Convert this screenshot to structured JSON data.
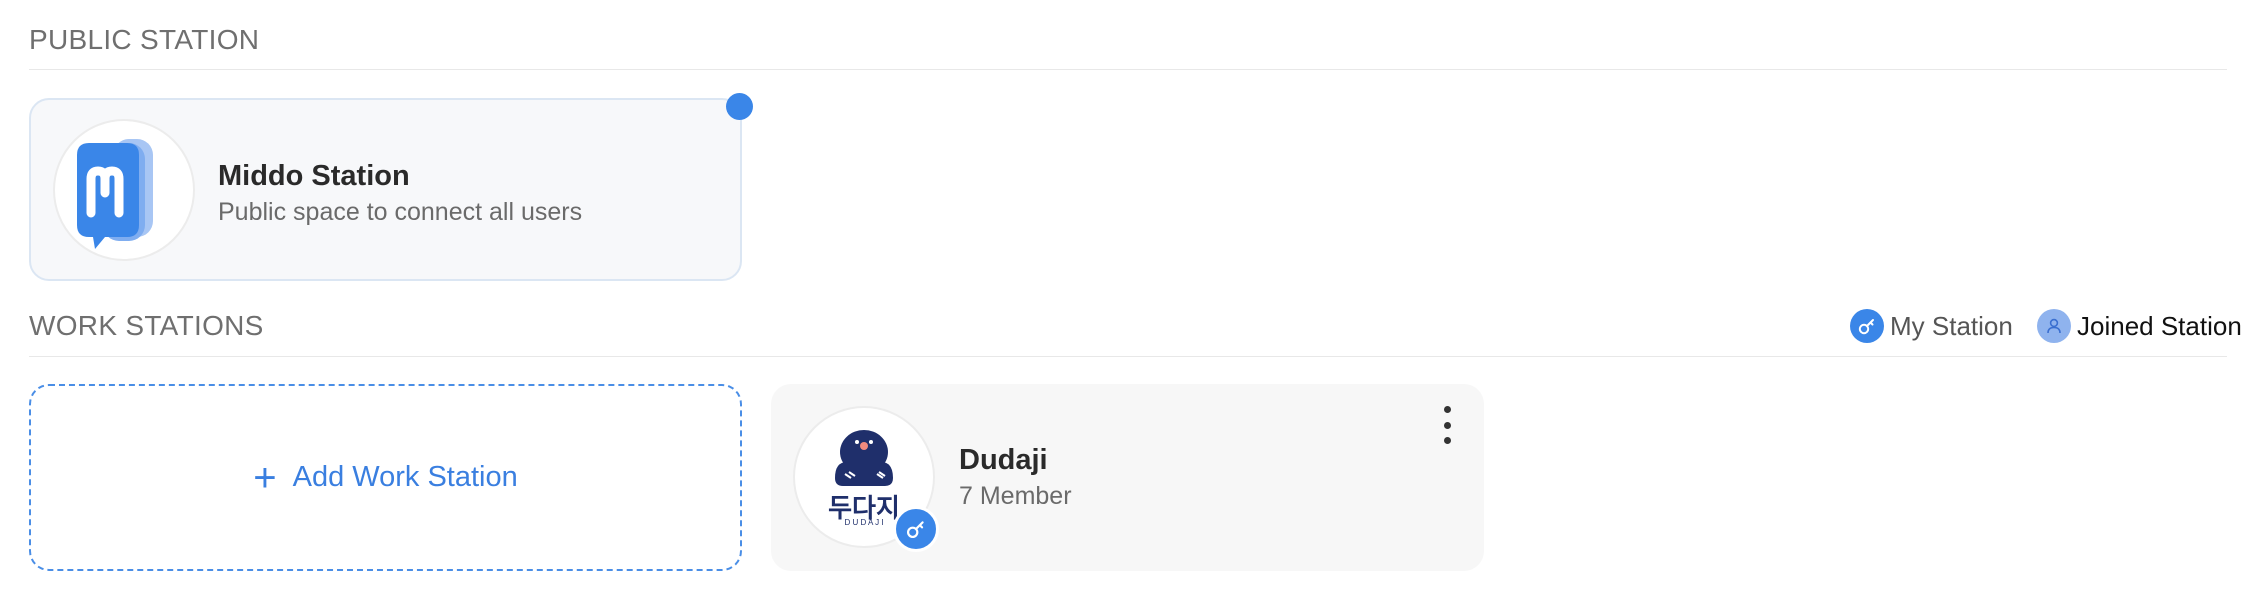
{
  "public_section": {
    "title": "PUBLIC STATION",
    "station": {
      "name": "Middo Station",
      "description": "Public space to connect all users",
      "logo_icon": "middo-logo-icon",
      "has_notification": true
    }
  },
  "work_section": {
    "title": "WORK STATIONS",
    "legend": {
      "my_station": {
        "label": "My Station",
        "icon": "key-icon",
        "color": "#3a86e8"
      },
      "joined_station": {
        "label": "Joined Station",
        "icon": "user-icon",
        "color": "#8fb3ee"
      }
    },
    "add_button_label": "Add Work Station",
    "stations": [
      {
        "name": "Dudaji",
        "members": "7 Member",
        "logo_text": "두다지",
        "logo_subtext": "D U D A J I",
        "role": "my-station"
      }
    ]
  },
  "colors": {
    "accent": "#3a86e8",
    "navy": "#1f2f6b"
  }
}
